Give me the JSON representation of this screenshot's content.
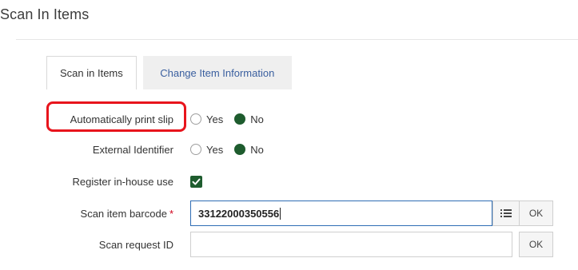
{
  "page": {
    "title": "Scan In Items"
  },
  "tabs": [
    {
      "label": "Scan in Items",
      "active": true
    },
    {
      "label": "Change Item Information",
      "active": false
    }
  ],
  "form": {
    "auto_print": {
      "label": "Automatically print slip",
      "options": [
        "Yes",
        "No"
      ],
      "selected": "No"
    },
    "external_id": {
      "label": "External Identifier",
      "options": [
        "Yes",
        "No"
      ],
      "selected": "No"
    },
    "inhouse": {
      "label": "Register in-house use",
      "checked": true
    },
    "barcode": {
      "label": "Scan item barcode",
      "required_marker": "*",
      "value": "33122000350556",
      "ok_label": "OK",
      "list_icon": "list-icon"
    },
    "request": {
      "label": "Scan request ID",
      "value": "",
      "ok_label": "OK"
    }
  },
  "colors": {
    "accent_green": "#1e5c2e",
    "highlight_red": "#e8141c",
    "focus_blue": "#2e6db4",
    "tab_link": "#3a5f9f"
  }
}
